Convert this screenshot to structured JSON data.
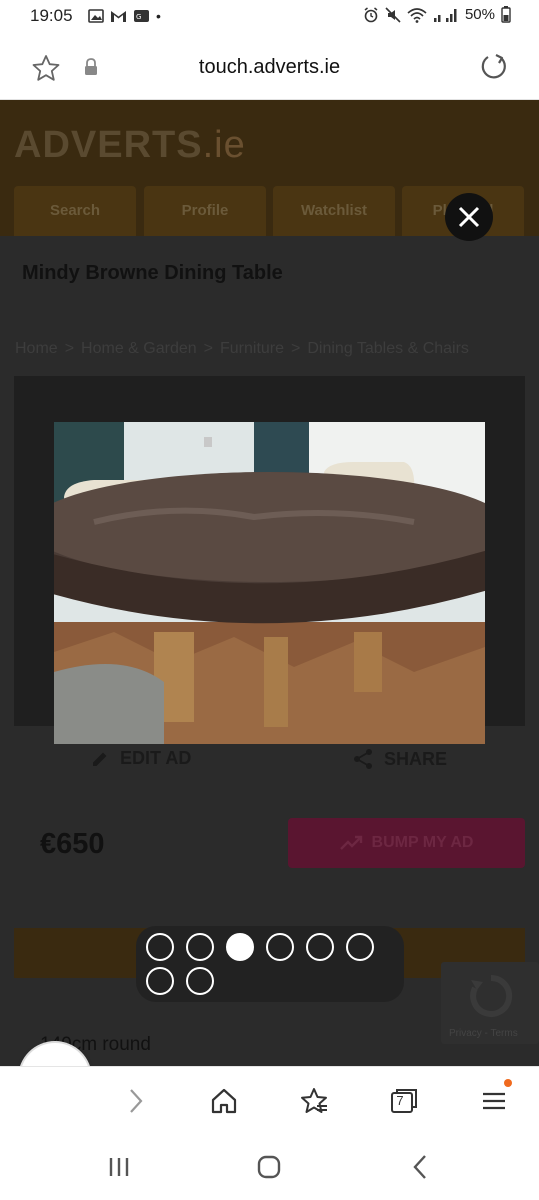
{
  "status_bar": {
    "time": "19:05",
    "dot": "•",
    "battery": "50%",
    "icons_left": [
      "image-icon",
      "gmail-icon",
      "bank-icon"
    ],
    "icons_right": [
      "alarm-icon",
      "mute-icon",
      "wifi-icon",
      "signal-icon",
      "battery-icon"
    ]
  },
  "url_bar": {
    "url": "touch.adverts.ie"
  },
  "site": {
    "logo_main": "ADVERTS",
    "logo_suffix": ".ie",
    "tabs": [
      {
        "label": "Search"
      },
      {
        "label": "Profile"
      },
      {
        "label": "Watchlist"
      },
      {
        "label": "Place ad"
      }
    ],
    "title": "Mindy Browne Dining Table",
    "breadcrumb": [
      "Home",
      "Home & Garden",
      "Furniture",
      "Dining Tables & Chairs"
    ],
    "breadcrumb_sep": ">",
    "actions": {
      "edit": "EDIT AD",
      "share": "SHARE"
    },
    "price": "€650",
    "bump_label": "BUMP MY AD",
    "description_partial": "140cm round",
    "recaptcha_text": "Privacy - Terms"
  },
  "lightbox": {
    "total_images": 8,
    "active_index": 2
  },
  "browser_bar": {
    "tab_count": "7"
  },
  "colors": {
    "adverts_orange": "#e8860f",
    "bump_pink": "#e0206a",
    "dim_overlay": "#2b2b2b"
  }
}
